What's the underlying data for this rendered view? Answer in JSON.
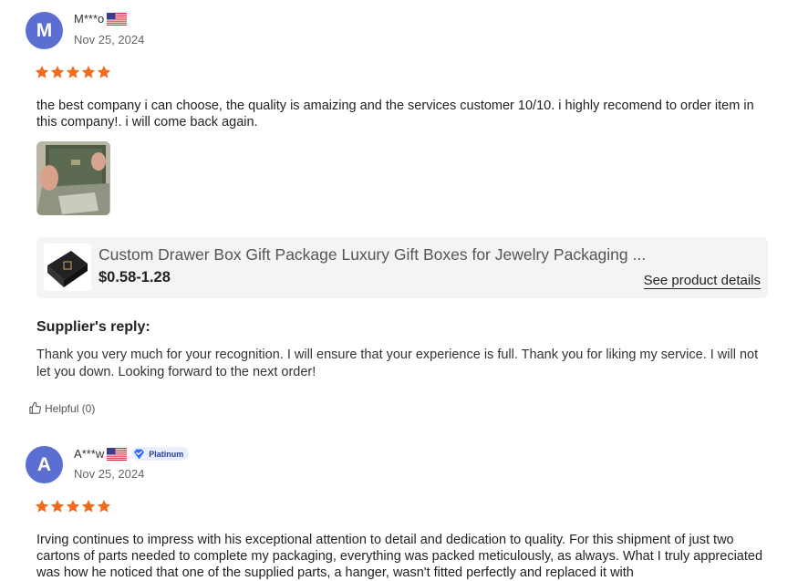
{
  "reviews": [
    {
      "avatar_letter": "M",
      "name": "M***o",
      "date": "Nov 25, 2024",
      "rating": 5,
      "text": "the best company i can choose, the quality is amaizing and the services customer 10/10. i highly recomend to order item in this company!. i will come back again.",
      "product": {
        "title": "Custom Drawer Box Gift Package Luxury Gift Boxes for Jewelry Packaging ...",
        "price": "$0.58-1.28",
        "details_label": "See product details"
      },
      "reply": {
        "title": "Supplier's reply:",
        "text": "Thank you very much for your recognition. I will ensure that your experience is full. Thank you for liking my service. I will not let you down. Looking forward to the next order!"
      },
      "helpful_label": "Helpful (0)"
    },
    {
      "avatar_letter": "A",
      "name": "A***w",
      "badge": "Platinum",
      "date": "Nov 25, 2024",
      "rating": 5,
      "text": "Irving continues to impress with his exceptional attention to detail and dedication to quality. For this shipment of just two cartons of parts needed to complete my packaging, everything was packed meticulously, as always. What I truly appreciated was how he noticed that one of the supplied parts, a hanger, wasn't fitted perfectly and replaced it with"
    }
  ],
  "colors": {
    "avatar": "#5a6fd1",
    "star": "#f26a1b",
    "card_bg": "#f4f4f4"
  }
}
